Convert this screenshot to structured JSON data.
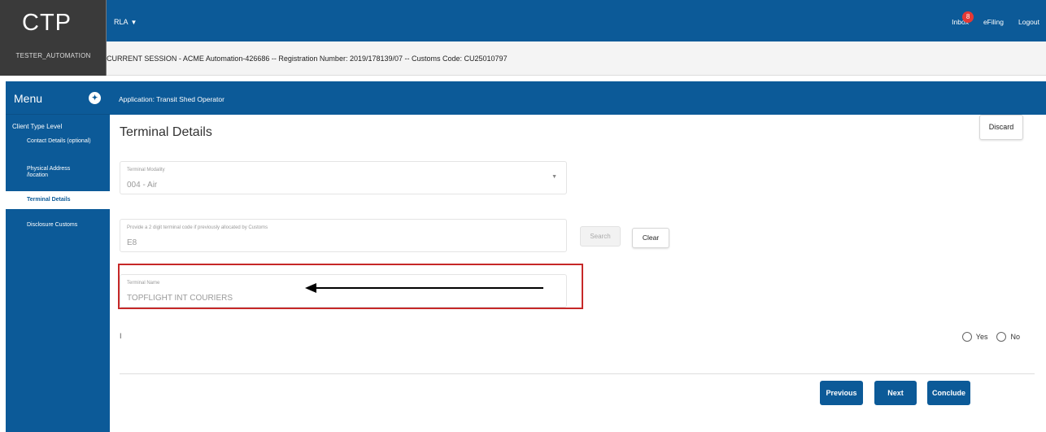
{
  "brand": {
    "logo": "CTP",
    "user": "TESTER_AUTOMATION"
  },
  "topbar": {
    "rla_label": "RLA",
    "inbox_label": "Inbox",
    "inbox_count": "8",
    "efiling_label": "eFiling",
    "logout_label": "Logout"
  },
  "session": {
    "text": "CURRENT SESSION - ACME Automation-426686 -- Registration Number: 2019/178139/07 -- Customs Code: CU25010797"
  },
  "menu": {
    "title": "Menu",
    "group": "Client Type Level",
    "items": [
      {
        "label": "Contact Details (optional)"
      },
      {
        "label": "Physical Address /location"
      },
      {
        "label": "Terminal Details"
      },
      {
        "label": "Disclosure Customs"
      }
    ]
  },
  "appbar": {
    "title": "Application: Transit Shed Operator"
  },
  "main": {
    "title": "Terminal Details",
    "modality": {
      "label": "Terminal Modality",
      "value": "004 - Air"
    },
    "code": {
      "label": "Provide a 2 digit terminal code if previously allocated by Customs",
      "value": "E8"
    },
    "search_label": "Search",
    "clear_label": "Clear",
    "terminal_name": {
      "label": "Terminal Name",
      "value": "TOPFLIGHT INT COURIERS"
    },
    "stray_text": "I",
    "yes_label": "Yes",
    "no_label": "No"
  },
  "footer": {
    "previous_label": "Previous",
    "next_label": "Next",
    "conclude_label": "Conclude",
    "discard_label": "Discard"
  },
  "colors": {
    "brand_blue": "#0c5a98",
    "highlight_red": "#c62828",
    "badge_red": "#e53935"
  },
  "icons": {
    "menu_toggle": "compass-icon",
    "dropdown": "caret-down-icon",
    "annotation": "arrow-left-icon"
  }
}
